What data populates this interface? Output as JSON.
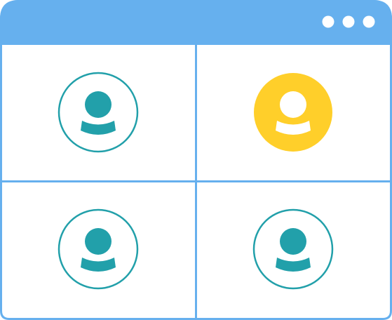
{
  "window": {
    "title_bar_color": "#66b0ee",
    "frame_color": "#66b0ee",
    "menu_icon": "more-dots-icon"
  },
  "participants": [
    {
      "id": "participant-1",
      "icon": "user-avatar-icon",
      "active_speaker": false,
      "color": "#22a0aa"
    },
    {
      "id": "participant-2",
      "icon": "user-avatar-icon",
      "active_speaker": true,
      "color": "#ffcf2a"
    },
    {
      "id": "participant-3",
      "icon": "user-avatar-icon",
      "active_speaker": false,
      "color": "#22a0aa"
    },
    {
      "id": "participant-4",
      "icon": "user-avatar-icon",
      "active_speaker": false,
      "color": "#22a0aa"
    }
  ]
}
